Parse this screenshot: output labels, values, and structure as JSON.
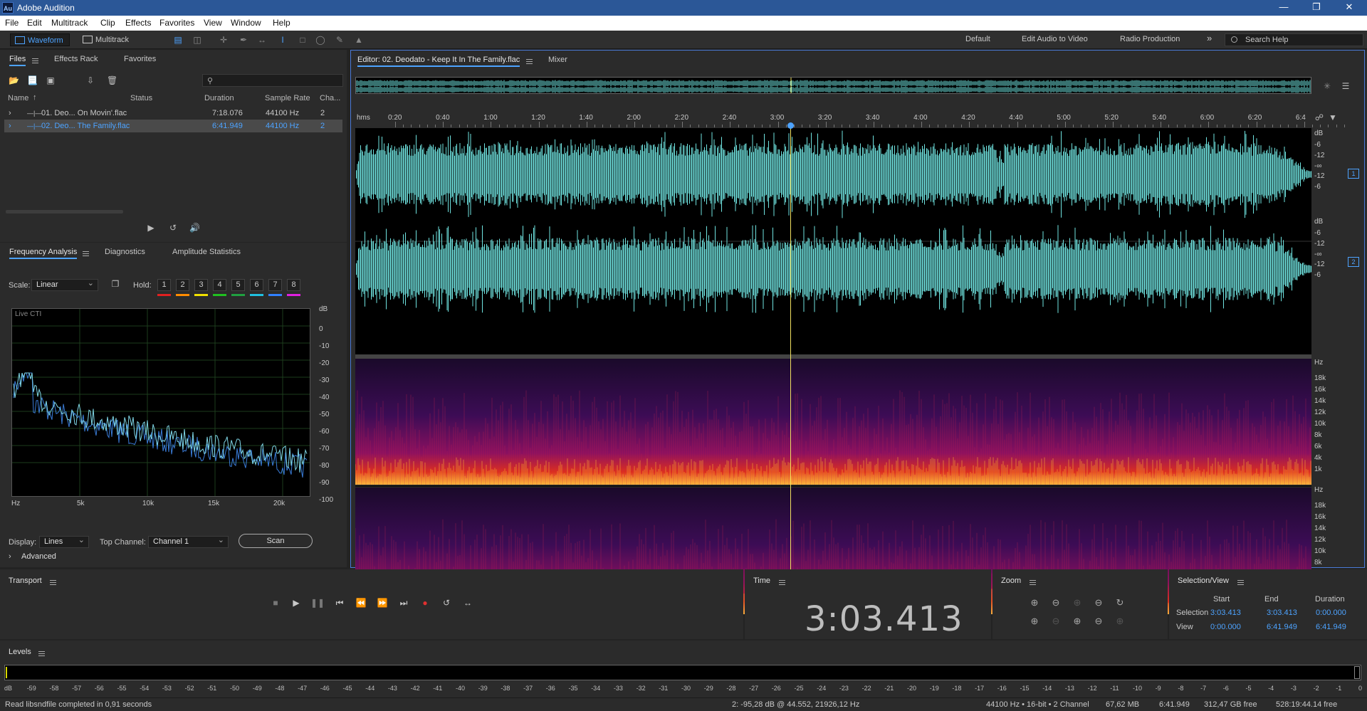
{
  "app": {
    "title": "Adobe Audition",
    "logo": "Au"
  },
  "menu": [
    "File",
    "Edit",
    "Multitrack",
    "Clip",
    "Effects",
    "Favorites",
    "View",
    "Window",
    "Help"
  ],
  "toolbar": {
    "waveform_label": "Waveform",
    "multitrack_label": "Multitrack",
    "workspaces": [
      "Default",
      "Edit Audio to Video",
      "Radio Production"
    ],
    "more_icon": "»",
    "search_placeholder": "Search Help"
  },
  "files_panel": {
    "tabs": [
      "Files",
      "Effects Rack",
      "Favorites"
    ],
    "columns": [
      "Name",
      "Status",
      "Duration",
      "Sample Rate",
      "Cha..."
    ],
    "rows": [
      {
        "name": "01. Deo... On Movin'.flac",
        "duration": "7:18.076",
        "rate": "44100 Hz",
        "ch": "2",
        "selected": false
      },
      {
        "name": "02. Deo... The Family.flac",
        "duration": "6:41.949",
        "rate": "44100 Hz",
        "ch": "2",
        "selected": true
      }
    ]
  },
  "freq_panel": {
    "tabs": [
      "Frequency Analysis",
      "Diagnostics",
      "Amplitude Statistics"
    ],
    "scale_label": "Scale:",
    "scale_value": "Linear",
    "hold_label": "Hold:",
    "hold_buttons": [
      "1",
      "2",
      "3",
      "4",
      "5",
      "6",
      "7",
      "8"
    ],
    "hold_colors": [
      "#e02020",
      "#ff8c00",
      "#f0e000",
      "#20c020",
      "#20a040",
      "#20c0e0",
      "#3080ff",
      "#e020e0"
    ],
    "plot_label": "Live CTI",
    "db_labels": [
      "dB",
      "0",
      "-10",
      "-20",
      "-30",
      "-40",
      "-50",
      "-60",
      "-70",
      "-80",
      "-90",
      "-100"
    ],
    "hz_labels": [
      "Hz",
      "5k",
      "10k",
      "15k",
      "20k"
    ],
    "display_label": "Display:",
    "display_value": "Lines",
    "top_channel_label": "Top Channel:",
    "top_channel_value": "Channel 1",
    "scan_label": "Scan",
    "advanced_label": "Advanced"
  },
  "editor": {
    "tab_label": "Editor: 02. Deodato - Keep It In The Family.flac",
    "mixer_label": "Mixer",
    "ruler_labels": [
      "hms",
      "0:20",
      "0:40",
      "1:00",
      "1:20",
      "1:40",
      "2:00",
      "2:20",
      "2:40",
      "3:00",
      "3:20",
      "3:40",
      "4:00",
      "4:20",
      "4:40",
      "5:00",
      "5:20",
      "5:40",
      "6:00",
      "6:20",
      "6:4"
    ],
    "db_labels_ch": [
      "dB",
      "-6",
      "-12",
      "-∞",
      "-12",
      "-6"
    ],
    "channel_badges": [
      "1",
      "2"
    ],
    "hz_labels": [
      "Hz",
      "18k",
      "16k",
      "14k",
      "12k",
      "10k",
      "8k",
      "6k",
      "4k",
      "1k"
    ],
    "playhead_fraction": 0.455,
    "wave_color": "#6fe3e0",
    "selection_color": "#4da3ff"
  },
  "transport": {
    "title": "Transport"
  },
  "time": {
    "title": "Time",
    "value": "3:03.413"
  },
  "zoom": {
    "title": "Zoom"
  },
  "selview": {
    "title": "Selection/View",
    "cols": [
      "Start",
      "End",
      "Duration"
    ],
    "selection_label": "Selection",
    "view_label": "View",
    "selection": [
      "3:03.413",
      "3:03.413",
      "0:00.000"
    ],
    "view": [
      "0:00.000",
      "6:41.949",
      "6:41.949"
    ]
  },
  "levels": {
    "title": "Levels",
    "labels": [
      "dB",
      "-59",
      "-58",
      "-57",
      "-56",
      "-55",
      "-54",
      "-53",
      "-52",
      "-51",
      "-50",
      "-49",
      "-48",
      "-47",
      "-46",
      "-45",
      "-44",
      "-43",
      "-42",
      "-41",
      "-40",
      "-39",
      "-38",
      "-37",
      "-36",
      "-35",
      "-34",
      "-33",
      "-32",
      "-31",
      "-30",
      "-29",
      "-28",
      "-27",
      "-26",
      "-25",
      "-24",
      "-23",
      "-22",
      "-21",
      "-20",
      "-19",
      "-18",
      "-17",
      "-16",
      "-15",
      "-14",
      "-13",
      "-12",
      "-11",
      "-10",
      "-9",
      "-8",
      "-7",
      "-6",
      "-5",
      "-4",
      "-3",
      "-2",
      "-1",
      "0"
    ]
  },
  "status": {
    "message": "Read libsndfile completed in 0,91 seconds",
    "cursor": "2: -95,28 dB @ 44.552, 21926,12 Hz",
    "format": "44100 Hz • 16-bit • 2 Channel",
    "size": "67,62 MB",
    "duration": "6:41.949",
    "free": "312,47 GB free",
    "free_time": "528:19:44.14 free"
  }
}
